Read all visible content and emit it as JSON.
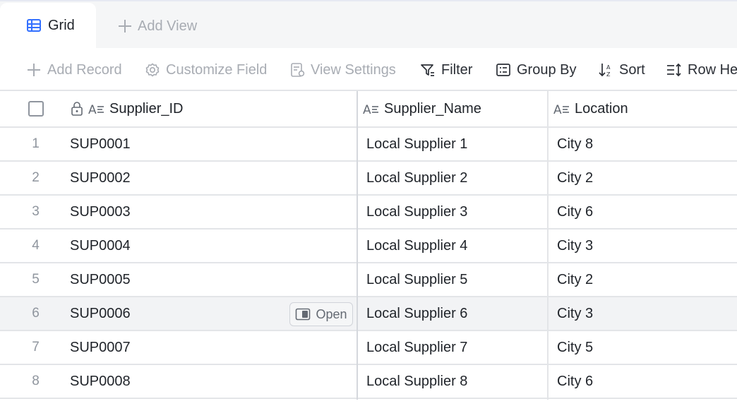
{
  "view_bar": {
    "active_tab": {
      "label": "Grid",
      "icon": "grid-table-icon"
    },
    "add_view_label": "Add View"
  },
  "toolbar": {
    "add_record": "Add Record",
    "customize_field": "Customize Field",
    "view_settings": "View Settings",
    "filter": "Filter",
    "group_by": "Group By",
    "sort": "Sort",
    "row_height": "Row He"
  },
  "columns": [
    {
      "label": "Supplier_ID",
      "icon": "text-field-icon",
      "locked": true
    },
    {
      "label": "Supplier_Name",
      "icon": "text-field-icon"
    },
    {
      "label": "Location",
      "icon": "text-field-icon"
    }
  ],
  "rows": [
    {
      "num": "1",
      "id": "SUP0001",
      "name": "Local Supplier 1",
      "location": "City 8"
    },
    {
      "num": "2",
      "id": "SUP0002",
      "name": "Local Supplier 2",
      "location": "City 2"
    },
    {
      "num": "3",
      "id": "SUP0003",
      "name": "Local Supplier 3",
      "location": "City 6"
    },
    {
      "num": "4",
      "id": "SUP0004",
      "name": "Local Supplier 4",
      "location": "City 3"
    },
    {
      "num": "5",
      "id": "SUP0005",
      "name": "Local Supplier 5",
      "location": "City 2"
    },
    {
      "num": "6",
      "id": "SUP0006",
      "name": "Local Supplier 6",
      "location": "City 3"
    },
    {
      "num": "7",
      "id": "SUP0007",
      "name": "Local Supplier 7",
      "location": "City 5"
    },
    {
      "num": "8",
      "id": "SUP0008",
      "name": "Local Supplier 8",
      "location": "City 6"
    }
  ],
  "hover_row_action": "Open",
  "colors": {
    "accent": "#3370ff",
    "muted_text": "#a8acb3",
    "tab_bar_bg": "#f5f6f7",
    "row_hover_bg": "#f2f3f5"
  }
}
